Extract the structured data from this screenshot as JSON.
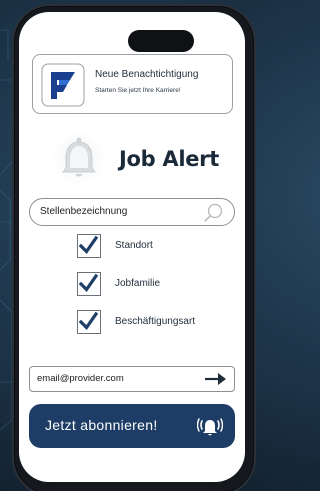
{
  "notification": {
    "title": "Neue Benachtichtigung",
    "subtitle": "Starten Sie jetzt Ihre Karriere!",
    "logo_icon": "company-logo-icon"
  },
  "header": {
    "title": "Job Alert",
    "icon": "bell-icon"
  },
  "search": {
    "placeholder": "Stellenbezeichnung",
    "icon": "search-icon"
  },
  "filters": [
    {
      "label": "Standort",
      "checked": true
    },
    {
      "label": "Jobfamilie",
      "checked": true
    },
    {
      "label": "Beschäftigungsart",
      "checked": true
    }
  ],
  "email": {
    "placeholder": "email@provider.com",
    "icon": "arrow-right-icon"
  },
  "subscribe": {
    "label": "Jetzt abonnieren!",
    "icon": "bell-ringing-icon"
  },
  "colors": {
    "background": "#1d3447",
    "button": "#1e3d66",
    "logo_blue": "#1b3f8f"
  }
}
